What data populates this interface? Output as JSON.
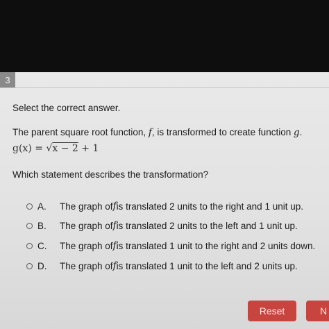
{
  "question_number": "3",
  "instruction": "Select the correct answer.",
  "prompt": {
    "before": "The parent square root function, ",
    "f": "f",
    "middle": ", is transformed to create function ",
    "g": "g",
    "after": "."
  },
  "function": {
    "lhs": "g(x) = ",
    "radicand": "x − 2",
    "rhs": " + 1"
  },
  "question": "Which statement describes the transformation?",
  "options": [
    {
      "letter": "A.",
      "pre": "The graph of ",
      "f": "f",
      "post": " is translated 2 units to the right and 1 unit up."
    },
    {
      "letter": "B.",
      "pre": "The graph of ",
      "f": "f",
      "post": " is translated 2 units to the left and 1 unit up."
    },
    {
      "letter": "C.",
      "pre": "The graph of ",
      "f": "f",
      "post": " is translated 1 unit to the right and 2 units down."
    },
    {
      "letter": "D.",
      "pre": "The graph of ",
      "f": "f",
      "post": " is translated 1 unit to the left and 2 units up."
    }
  ],
  "buttons": {
    "reset": "Reset",
    "next": "N"
  }
}
